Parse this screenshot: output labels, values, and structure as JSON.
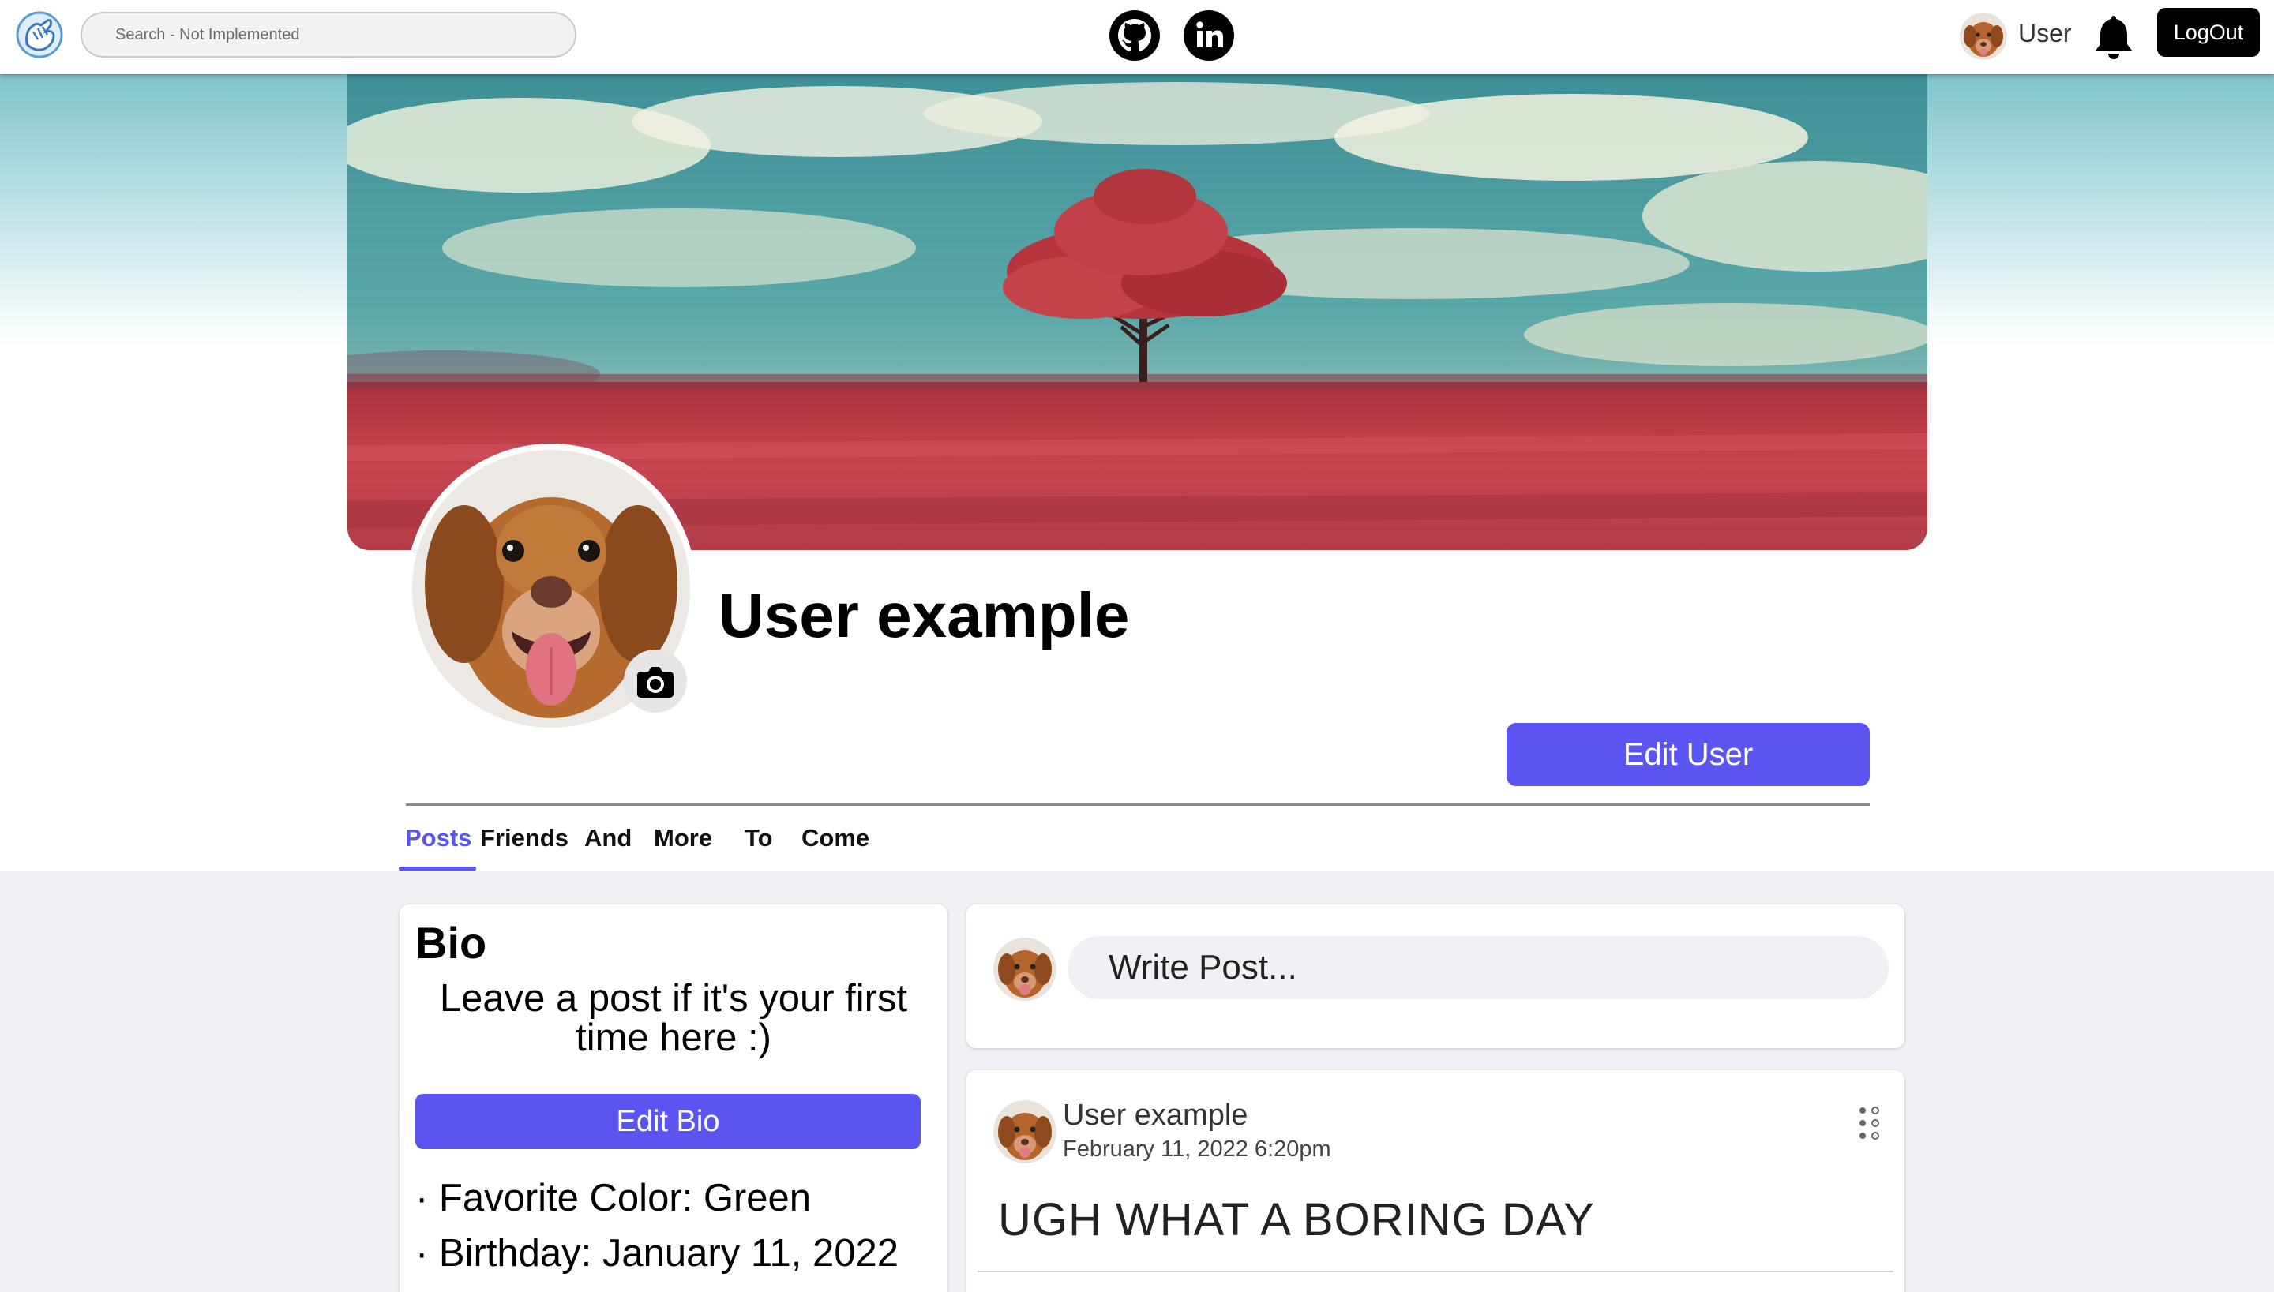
{
  "navbar": {
    "search_placeholder": "Search - Not Implemented",
    "icons": [
      "hand-logo-icon",
      "github-icon",
      "linkedin-icon",
      "bell-icon"
    ],
    "user_label": "User",
    "logout_label": "LogOut"
  },
  "profile": {
    "name": "User example",
    "edit_user_label": "Edit User"
  },
  "tabs": [
    {
      "label": "Posts",
      "active": true
    },
    {
      "label": "Friends",
      "active": false
    },
    {
      "label": "And",
      "active": false
    },
    {
      "label": "More",
      "active": false
    },
    {
      "label": "To",
      "active": false
    },
    {
      "label": "Come",
      "active": false
    }
  ],
  "bio": {
    "title": "Bio",
    "text": "Leave a post if it's your first time here :)",
    "edit_label": "Edit Bio",
    "facts": [
      "· Favorite Color: Green",
      "· Birthday: January 11, 2022"
    ]
  },
  "write_post": {
    "placeholder": "Write Post..."
  },
  "post": {
    "author": "User example",
    "date": "February 11, 2022 6:20pm",
    "body": "UGH WHAT A BORING DAY"
  },
  "colors": {
    "accent": "#5a55f0",
    "content_background": "#f0f1f5",
    "logout_background": "#000000"
  }
}
